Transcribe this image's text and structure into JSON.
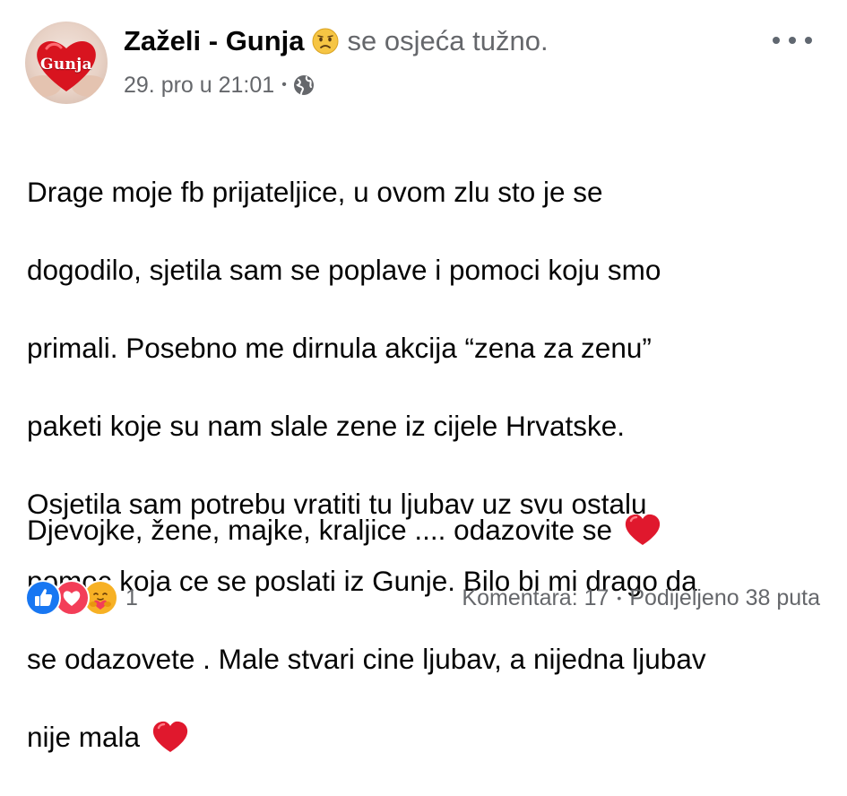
{
  "post": {
    "author": "Zaželi - Gunja",
    "feeling_emoji": "sad-face-emoji",
    "feeling_text": "se osjeća tužno.",
    "timestamp": "29. pro u 21:01",
    "meta_separator": "•",
    "privacy_icon": "globe-icon",
    "avatar_label": "Gunja",
    "more_icon": "ellipsis-icon",
    "body_lines": [
      "Drage moje fb prijateljice, u ovom zlu sto je se",
      "dogodilo, sjetila sam se poplave i pomoci koju smo",
      "primali. Posebno me dirnula akcija “zena za zenu”",
      "paketi koje su nam slale zene iz cijele Hrvatske.",
      "Osjetila sam potrebu vratiti tu ljubav uz svu ostalu",
      "pomoc koja ce se poslati iz Gunje. Bilo bi mi drago da",
      "se odazovete . Male stvari cine ljubav, a nijedna ljubav",
      "nije mala"
    ],
    "closing_line": "Djevojke, žene, majke, kraljice .... odazovite se",
    "heart_emoji": "red-heart-emoji"
  },
  "footer": {
    "reaction_icons": [
      "like-reaction-icon",
      "love-reaction-icon",
      "care-reaction-icon"
    ],
    "reaction_count": "1",
    "comments": "Komentara: 17",
    "separator": "•",
    "shares": "Podijeljeno 38 puta"
  },
  "colors": {
    "text": "#050505",
    "secondary": "#65676b",
    "like": "#1877f2",
    "love": "#f33e58",
    "care": "#f7b125",
    "heart": "#e0182d"
  }
}
